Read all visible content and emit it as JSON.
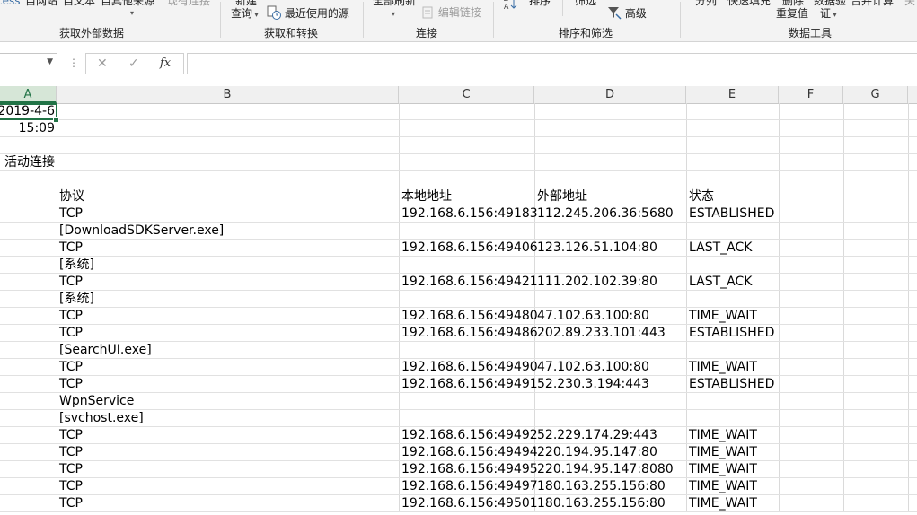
{
  "ribbon": {
    "get_external_data": {
      "items": [
        "cess",
        "自网站",
        "自文本",
        "自其他来源",
        "现有连接"
      ],
      "label": "获取外部数据"
    },
    "get_transform": {
      "new_query": "新建",
      "new_query_2": "查询",
      "recent_sources": "最近使用的源",
      "label": "获取和转换"
    },
    "connections": {
      "refresh_all": "全部刷新",
      "edit_links": "编辑链接",
      "label": "连接"
    },
    "sort_filter": {
      "sort": "排序",
      "filter": "筛选",
      "advanced": "高级",
      "label": "排序和筛选"
    },
    "data_tools": {
      "text_to_columns": "分列",
      "flash_fill": "快速填充",
      "remove_dup_1": "删除",
      "remove_dup_2": "重复值",
      "validation_1": "数据验",
      "validation_2": "证",
      "consolidate": "合并计算",
      "relation": "关",
      "label": "数据工具"
    }
  },
  "formula_bar": {
    "name_box": "",
    "cancel": "✕",
    "enter": "✓",
    "fx": "fx",
    "formula": ""
  },
  "columns": [
    "A",
    "B",
    "C",
    "D",
    "E",
    "F",
    "G"
  ],
  "rows": [
    {
      "a": "2019-4-6"
    },
    {
      "a": "15:09"
    },
    {},
    {
      "a": "活动连接"
    },
    {},
    {
      "b": "协议",
      "c": "本地地址",
      "d": "外部地址",
      "e": "状态"
    },
    {
      "b": "TCP",
      "c": "192.168.6.156:49183",
      "d": "112.245.206.36:5680",
      "e": "ESTABLISHED"
    },
    {
      "b": "[DownloadSDKServer.exe]"
    },
    {
      "b": "TCP",
      "c": "192.168.6.156:49406",
      "d": "123.126.51.104:80",
      "e": "LAST_ACK"
    },
    {
      "b": "[系统]"
    },
    {
      "b": "TCP",
      "c": "192.168.6.156:49421",
      "d": "111.202.102.39:80",
      "e": "LAST_ACK"
    },
    {
      "b": "[系统]"
    },
    {
      "b": "TCP",
      "c": "192.168.6.156:49480",
      "d": "47.102.63.100:80",
      "e": "TIME_WAIT"
    },
    {
      "b": "TCP",
      "c": "192.168.6.156:49486",
      "d": "202.89.233.101:443",
      "e": "ESTABLISHED"
    },
    {
      "b": "[SearchUI.exe]"
    },
    {
      "b": "TCP",
      "c": "192.168.6.156:49490",
      "d": "47.102.63.100:80",
      "e": "TIME_WAIT"
    },
    {
      "b": "TCP",
      "c": "192.168.6.156:49491",
      "d": "52.230.3.194:443",
      "e": "ESTABLISHED"
    },
    {
      "b": "WpnService"
    },
    {
      "b": "[svchost.exe]"
    },
    {
      "b": "TCP",
      "c": "192.168.6.156:49492",
      "d": "52.229.174.29:443",
      "e": "TIME_WAIT"
    },
    {
      "b": "TCP",
      "c": "192.168.6.156:49494",
      "d": "220.194.95.147:80",
      "e": "TIME_WAIT"
    },
    {
      "b": "TCP",
      "c": "192.168.6.156:49495",
      "d": "220.194.95.147:8080",
      "e": "TIME_WAIT"
    },
    {
      "b": "TCP",
      "c": "192.168.6.156:49497",
      "d": "180.163.255.156:80",
      "e": "TIME_WAIT"
    },
    {
      "b": "TCP",
      "c": "192.168.6.156:49501",
      "d": "180.163.255.156:80",
      "e": "TIME_WAIT"
    }
  ],
  "colors": {
    "accent": "#217346",
    "ribbon_bg": "#f3f3f3",
    "header_bg": "#f0f0f0"
  }
}
